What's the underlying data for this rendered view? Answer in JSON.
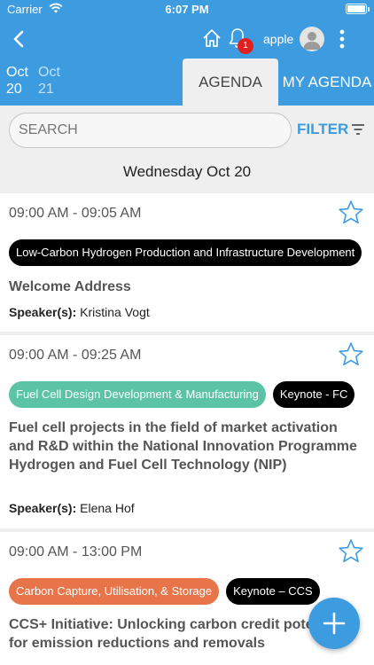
{
  "status_bar": {
    "carrier": "Carrier",
    "time": "6:07 PM",
    "battery_level": 1.0
  },
  "nav": {
    "back_icon": "chevron-left-icon",
    "home_icon": "home-icon",
    "bell_icon": "bell-icon",
    "notification_count": "1",
    "user_name": "apple",
    "more_icon": "more-vertical-icon"
  },
  "dates": [
    {
      "month": "Oct",
      "day": "20",
      "selected": true
    },
    {
      "month": "Oct",
      "day": "21",
      "selected": false
    }
  ],
  "view_tabs": {
    "agenda": "AGENDA",
    "my_agenda": "MY AGENDA"
  },
  "search": {
    "placeholder": "SEARCH",
    "filter_label": "FILTER"
  },
  "day_header": "Wednesday Oct 20",
  "sessions": [
    {
      "time": "09:00 AM - 09:05 AM",
      "tags": [
        {
          "label": "Low-Carbon Hydrogen Production and Infrastructure Development",
          "color": "#000000"
        }
      ],
      "title": "Welcome Address",
      "speaker_label": "Speaker(s):",
      "speaker": "Kristina Vogt"
    },
    {
      "time": "09:00 AM - 09:25 AM",
      "tags": [
        {
          "label": "Fuel Cell Design Development & Manufacturing",
          "color": "#5cc3a6"
        },
        {
          "label": "Keynote - FC",
          "color": "#000000"
        }
      ],
      "title": "Fuel cell projects in the field of market activation and R&D within the National Innovation Programme Hydrogen and Fuel Cell Technology (NIP)",
      "speaker_label": "Speaker(s):",
      "speaker": "Elena Hof"
    },
    {
      "time": "09:00 AM - 13:00 PM",
      "tags": [
        {
          "label": "Carbon Capture, Utilisation, & Storage",
          "color": "#e8744a"
        },
        {
          "label": "Keynote – CCS",
          "color": "#000000"
        }
      ],
      "title": "CCS+ Initiative: Unlocking carbon credit potential for emission reductions and removals",
      "speaker_label": "",
      "speaker": ""
    }
  ],
  "fab_icon": "plus-icon",
  "colors": {
    "primary": "#3d9be0",
    "background": "#efefef",
    "badge": "#e02020"
  }
}
